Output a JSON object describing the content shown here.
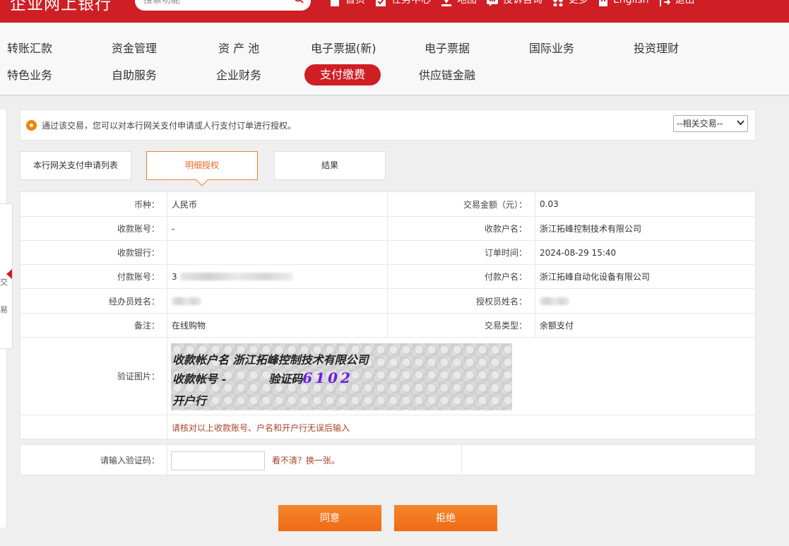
{
  "header": {
    "brand": "企业网上银行",
    "search_placeholder": "搜索功能",
    "nav": [
      {
        "icon": "home-icon",
        "label": "首页"
      },
      {
        "icon": "task-check-icon",
        "label": "任务中心"
      },
      {
        "icon": "map-pin-icon",
        "label": "地图"
      },
      {
        "icon": "chat-bubble-icon",
        "label": "投诉咨询"
      },
      {
        "icon": "more-grid-icon",
        "label": "更多"
      },
      {
        "icon": "building-icon",
        "label": "English"
      },
      {
        "icon": "logout-icon",
        "label": "退出"
      }
    ]
  },
  "menu": {
    "row1": [
      "转账汇款",
      "资金管理",
      "资 产 池",
      "电子票据(新)",
      "电子票据",
      "国际业务",
      "投资理财"
    ],
    "row2": [
      "特色业务",
      "自助服务",
      "企业财务",
      "支付缴费",
      "供应链金融"
    ],
    "active": "支付缴费"
  },
  "notice": {
    "text": "通过该交易，您可以对本行网关支付申请或人行支付订单进行授权。",
    "related_select": "--相关交易--"
  },
  "steps": [
    "本行网关支付申请列表",
    "明细授权",
    "结果"
  ],
  "detail": {
    "rows": [
      {
        "l1": "币种：",
        "v1": "人民币",
        "l2": "交易金额（元）：",
        "v2": "0.03"
      },
      {
        "l1": "收款账号：",
        "v1": "-",
        "l2": "收款户名：",
        "v2": "浙江拓峰控制技术有限公司"
      },
      {
        "l1": "收款银行：",
        "v1": "",
        "l2": "订单时间：",
        "v2": "2024-08-29 15:40"
      },
      {
        "l1": "付款账号：",
        "v1": "3",
        "l2": "付款户名：",
        "v2": "浙江拓峰自动化设备有限公司"
      },
      {
        "l1": "经办员姓名：",
        "v1": "",
        "l2": "授权员姓名：",
        "v2": ""
      },
      {
        "l1": "备注：",
        "v1": "在线购物",
        "l2": "交易类型：",
        "v2": "余额支付"
      }
    ],
    "captcha_label": "验证图片：",
    "captcha": {
      "line1": "收款帐户名 浙江拓峰控制技术有限公司",
      "line2_label": "收款帐号 -",
      "line2_code_label": "验证码",
      "line2_code": "6102",
      "line3": "开户行"
    },
    "warning": "请核对以上收款账号、户名和开户行无误后输入"
  },
  "verify": {
    "label": "请输入验证码：",
    "input_value": "",
    "refresh_link": "看不清？换一张。"
  },
  "buttons": {
    "agree": "同意",
    "reject": "拒绝"
  },
  "side": {
    "chars": [
      "交",
      "易"
    ]
  },
  "colors": {
    "brand_red": "#cf1e24",
    "accent_orange": "#ef6a14"
  }
}
